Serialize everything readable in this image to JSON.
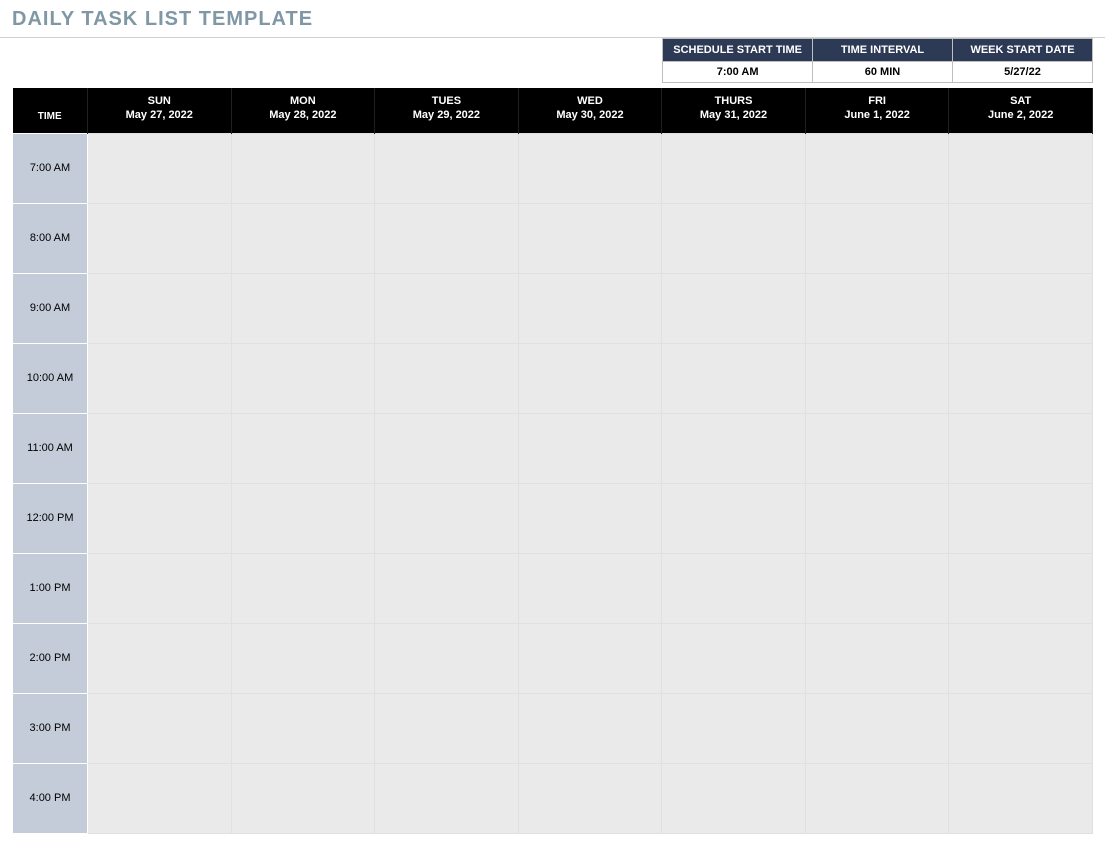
{
  "title": "DAILY TASK LIST TEMPLATE",
  "meta": {
    "headers": [
      "SCHEDULE START TIME",
      "TIME INTERVAL",
      "WEEK START DATE"
    ],
    "values": [
      "7:00 AM",
      "60 MIN",
      "5/27/22"
    ]
  },
  "schedule": {
    "time_header": "TIME",
    "days": [
      {
        "name": "SUN",
        "date": "May 27, 2022"
      },
      {
        "name": "MON",
        "date": "May 28, 2022"
      },
      {
        "name": "TUES",
        "date": "May 29, 2022"
      },
      {
        "name": "WED",
        "date": "May 30, 2022"
      },
      {
        "name": "THURS",
        "date": "May 31, 2022"
      },
      {
        "name": "FRI",
        "date": "June 1, 2022"
      },
      {
        "name": "SAT",
        "date": "June 2, 2022"
      }
    ],
    "times": [
      "7:00 AM",
      "8:00 AM",
      "9:00 AM",
      "10:00 AM",
      "11:00 AM",
      "12:00 PM",
      "1:00 PM",
      "2:00 PM",
      "3:00 PM",
      "4:00 PM"
    ]
  }
}
